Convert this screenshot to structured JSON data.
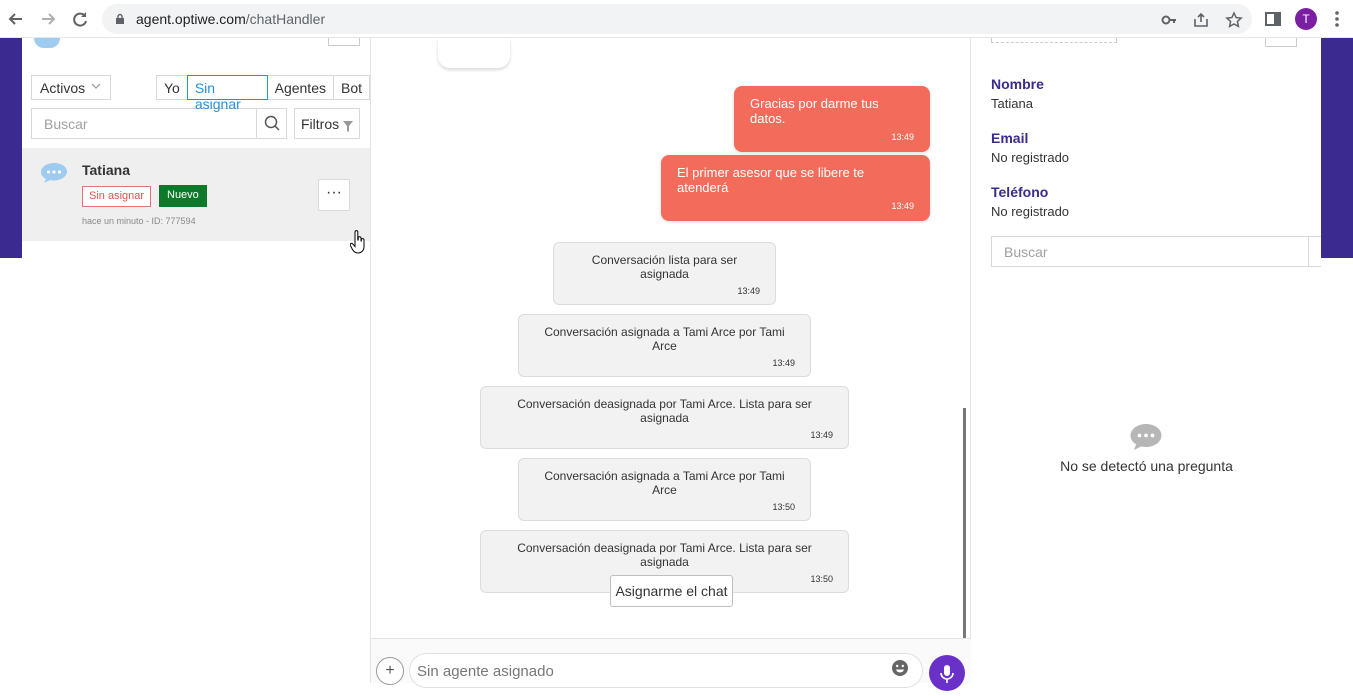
{
  "browser": {
    "url_domain": "agent.optiwe.com",
    "url_path": "/chatHandler",
    "profile_initial": "T"
  },
  "sidebar": {
    "status_filter": "Activos",
    "segments": [
      "Yo",
      "Sin asignar",
      "Agentes",
      "Bot"
    ],
    "active_segment": "Sin asignar",
    "search_placeholder": "Buscar",
    "filters_label": "Filtros",
    "conversations": [
      {
        "name": "Tatiana",
        "status_badge": "Sin asignar",
        "new_badge": "Nuevo",
        "meta": "hace un minuto - ID: 777594",
        "more_label": "···"
      }
    ]
  },
  "chat": {
    "outgoing": [
      {
        "text": "Gracias por darme tus datos.",
        "time": "13:49"
      },
      {
        "text": "El primer asesor que se libere te atenderá",
        "time": "13:49"
      }
    ],
    "system": [
      {
        "text": "Conversación lista para ser asignada",
        "time": "13:49"
      },
      {
        "text": "Conversación asignada a Tami Arce por Tami Arce",
        "time": "13:49"
      },
      {
        "text": "Conversación deasignada por Tami Arce. Lista para ser asignada",
        "time": "13:49"
      },
      {
        "text": "Conversación asignada a Tami Arce por Tami Arce",
        "time": "13:50"
      },
      {
        "text": "Conversación deasignada por Tami Arce. Lista para ser asignada",
        "time": "13:50"
      }
    ],
    "assign_button": "Asignarme el chat",
    "composer_placeholder": "Sin agente asignado",
    "plus_label": "+"
  },
  "contact": {
    "name_label": "Nombre",
    "name_value": "Tatiana",
    "email_label": "Email",
    "email_value": "No registrado",
    "phone_label": "Teléfono",
    "phone_value": "No registrado",
    "search_placeholder": "Buscar",
    "empty_text": "No se detectó una pregunta"
  },
  "colors": {
    "brand_purple": "#3b2a8f",
    "outgoing_bubble": "#f36c5b",
    "accent_blue": "#2a8fd6",
    "new_badge": "#0d7a2a",
    "mic_button": "#6a31c8"
  },
  "icons": [
    "back-icon",
    "forward-icon",
    "reload-icon",
    "lock-icon",
    "key-icon",
    "share-icon",
    "star-icon",
    "sidepanel-icon",
    "kebab-icon",
    "chevron-down-icon",
    "search-icon",
    "filter-icon",
    "chat-bubble-icon",
    "more-icon",
    "emoji-icon",
    "mic-icon"
  ]
}
